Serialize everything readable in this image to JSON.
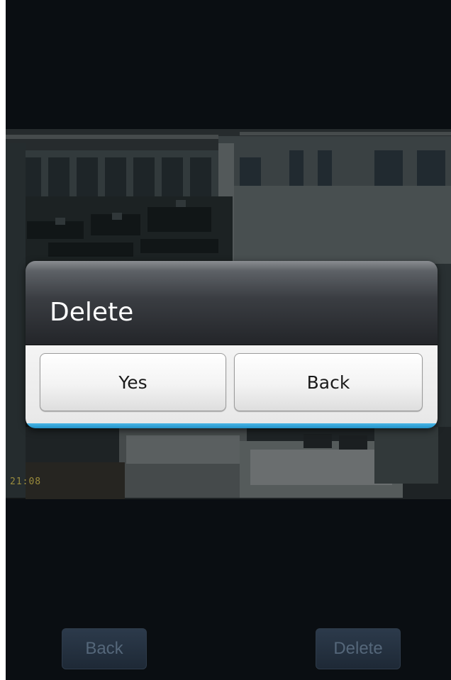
{
  "camera": {
    "timestamp": "21:08"
  },
  "dialog": {
    "title": "Delete",
    "yes_label": "Yes",
    "back_label": "Back"
  },
  "bottom_bar": {
    "back_label": "Back",
    "delete_label": "Delete"
  },
  "colors": {
    "dialog_accent": "#1e8dc4",
    "background": "#0a0e12"
  }
}
